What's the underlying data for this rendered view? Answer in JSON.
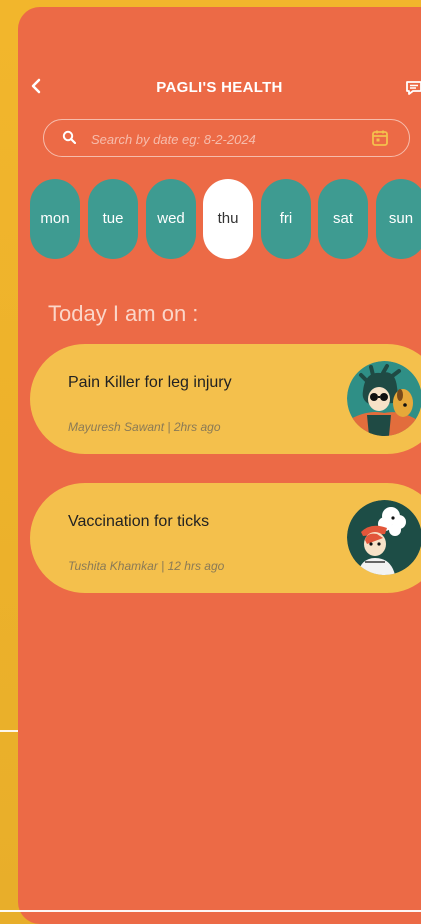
{
  "header": {
    "title": "PAGLI'S HEALTH"
  },
  "search": {
    "placeholder": "Search by date eg: 8-2-2024"
  },
  "days": [
    {
      "label": "mon",
      "active": false
    },
    {
      "label": "tue",
      "active": false
    },
    {
      "label": "wed",
      "active": false
    },
    {
      "label": "thu",
      "active": true
    },
    {
      "label": "fri",
      "active": false
    },
    {
      "label": "sat",
      "active": false
    },
    {
      "label": "sun",
      "active": false
    }
  ],
  "section": {
    "title": "Today I am on :"
  },
  "cards": [
    {
      "title": "Pain Killer for leg injury",
      "meta": "Mayuresh Sawant | 2hrs ago",
      "avatar": "person-with-dog-avatar"
    },
    {
      "title": "Vaccination for ticks",
      "meta": "Tushita Khamkar | 12 hrs ago",
      "avatar": "person-with-poodle-avatar"
    }
  ],
  "colors": {
    "background": "#ec6a46",
    "side": "#f2b62c",
    "day_pill": "#3e9b91",
    "card": "#f4c04c"
  }
}
